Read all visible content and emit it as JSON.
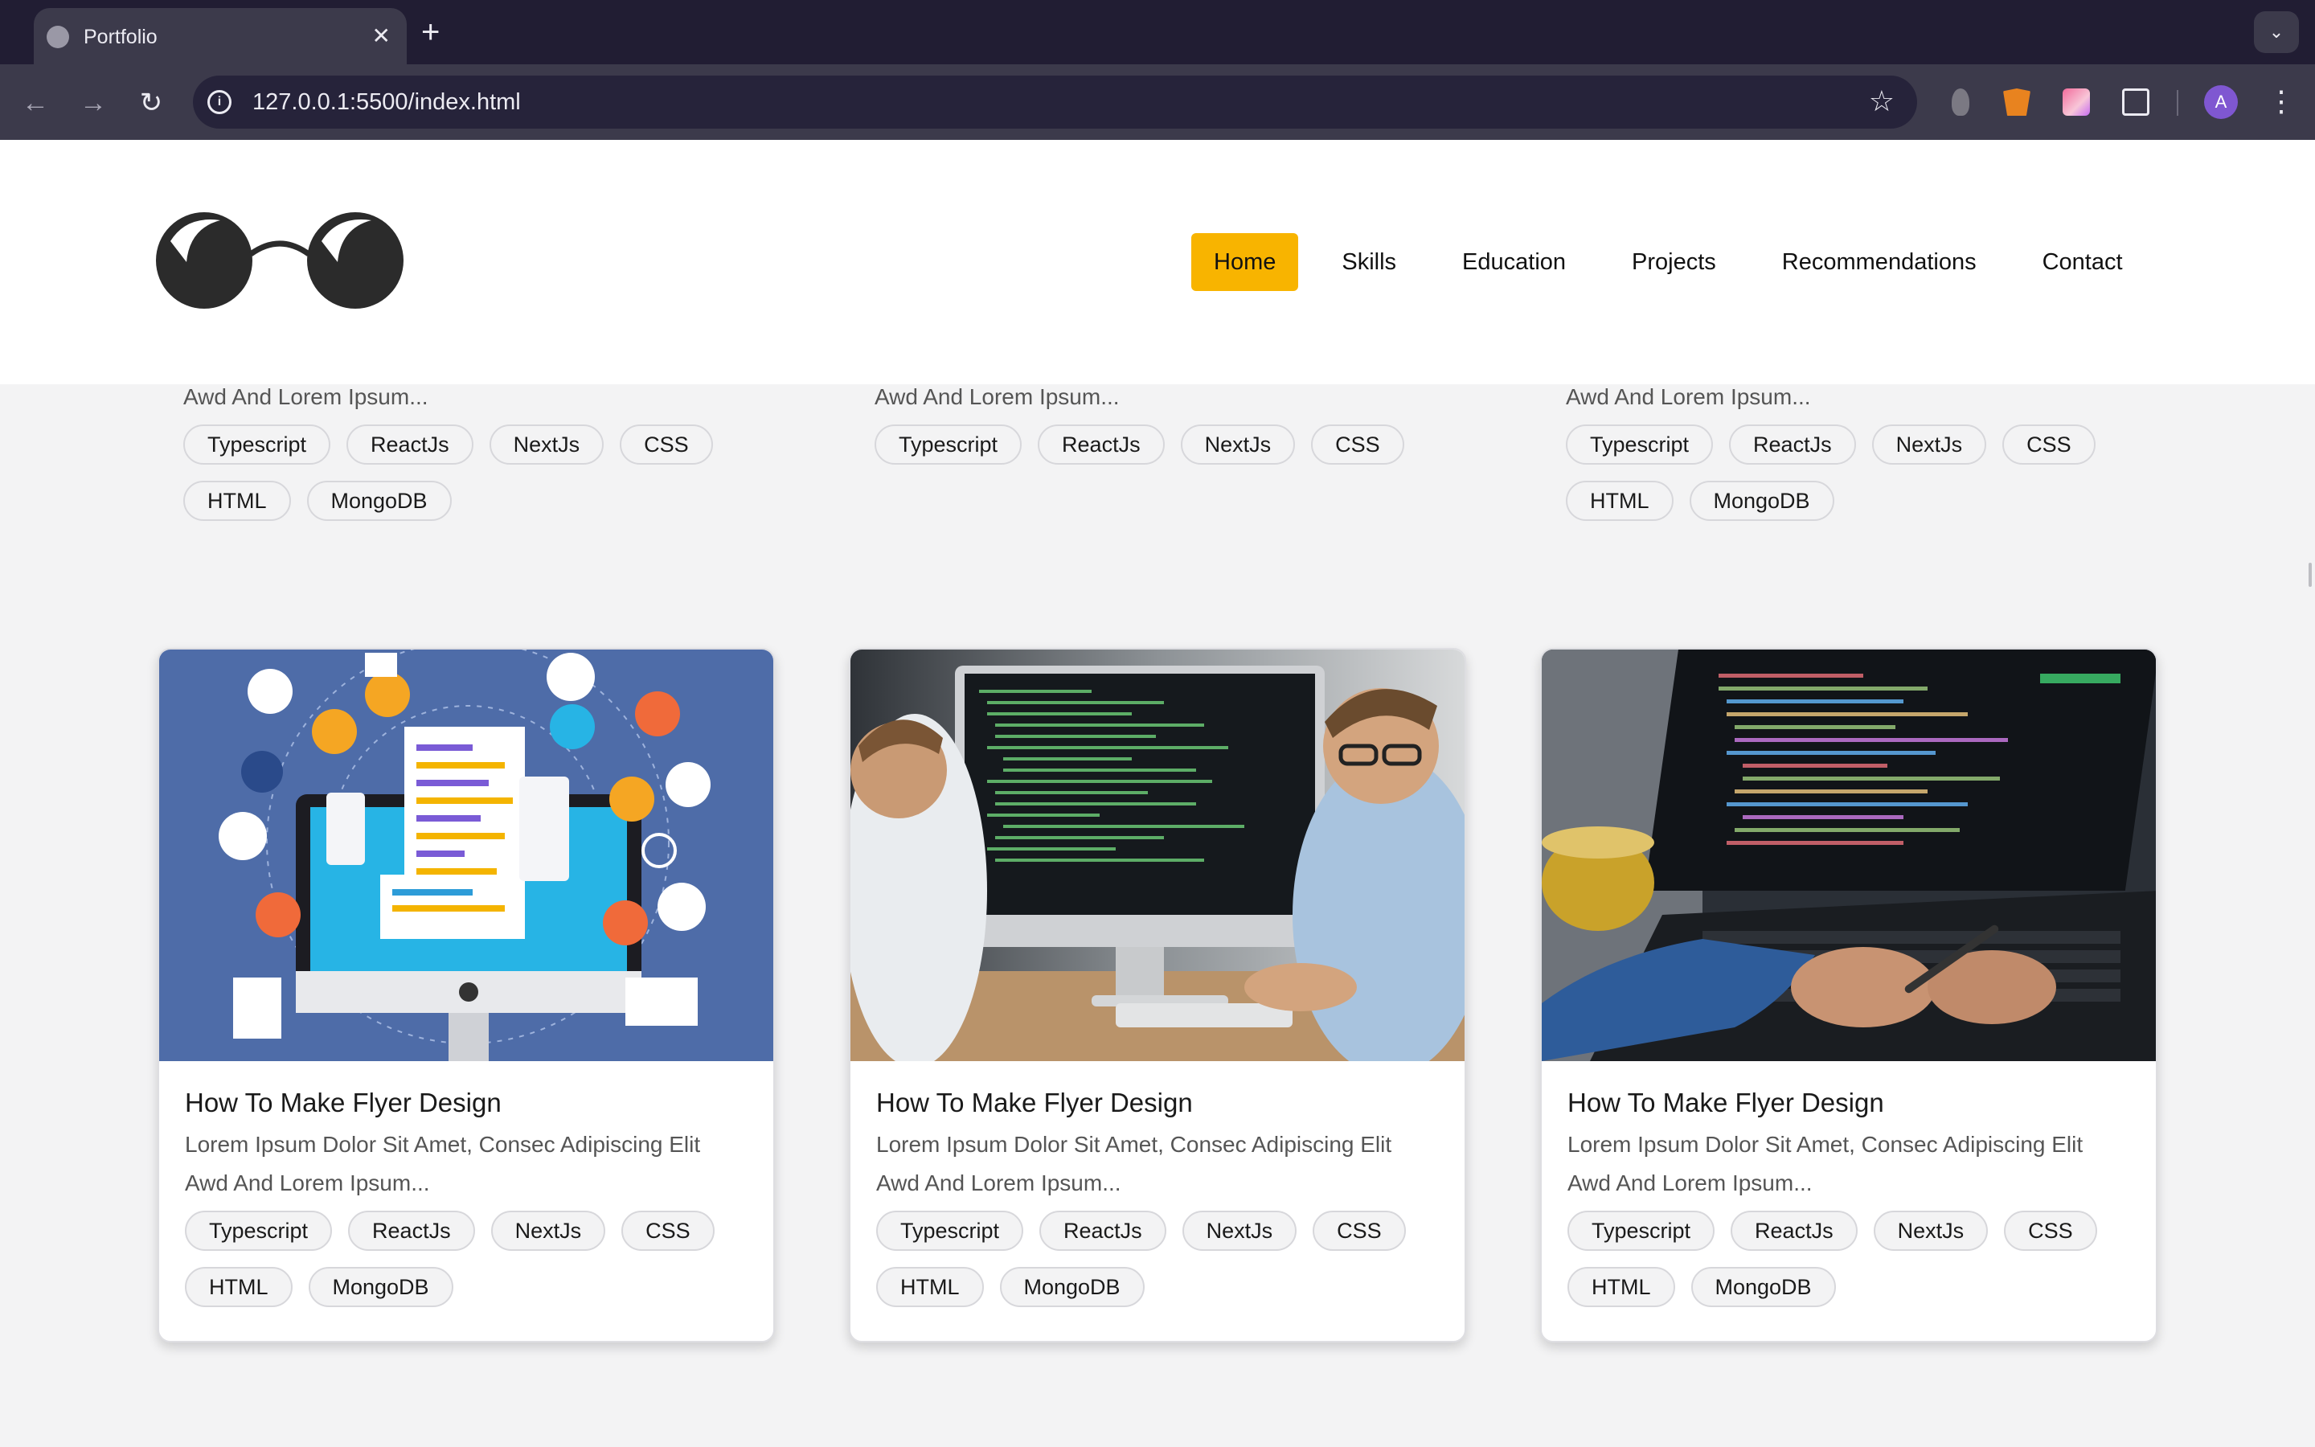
{
  "browser": {
    "tab_title": "Portfolio",
    "tab_close": "✕",
    "new_tab": "+",
    "tab_menu": "⌄",
    "url": "127.0.0.1:5500/index.html",
    "back": "←",
    "forward": "→",
    "reload": "↻",
    "star": "☆",
    "menu": "⋮",
    "profile_initial": "A",
    "info_icon": "i"
  },
  "site": {
    "nav": [
      "Home",
      "Skills",
      "Education",
      "Projects",
      "Recommendations",
      "Contact"
    ],
    "active_nav": "Home",
    "accent_color": "#f8b400"
  },
  "cards_top": [
    {
      "desc_line2": "Awd And Lorem Ipsum...",
      "tags": [
        "Typescript",
        "ReactJs",
        "NextJs",
        "CSS",
        "HTML",
        "MongoDB"
      ]
    },
    {
      "desc_line2": "Awd And Lorem Ipsum...",
      "tags": [
        "Typescript",
        "ReactJs",
        "NextJs",
        "CSS"
      ]
    },
    {
      "desc_line2": "Awd And Lorem Ipsum...",
      "tags": [
        "Typescript",
        "ReactJs",
        "NextJs",
        "CSS",
        "HTML",
        "MongoDB"
      ]
    }
  ],
  "cards": [
    {
      "title": "How To Make Flyer Design",
      "desc_line1": "Lorem Ipsum Dolor Sit Amet, Consec Adipiscing Elit",
      "desc_line2": "Awd And Lorem Ipsum...",
      "tags": [
        "Typescript",
        "ReactJs",
        "NextJs",
        "CSS",
        "HTML",
        "MongoDB"
      ]
    },
    {
      "title": "How To Make Flyer Design",
      "desc_line1": "Lorem Ipsum Dolor Sit Amet, Consec Adipiscing Elit",
      "desc_line2": "Awd And Lorem Ipsum...",
      "tags": [
        "Typescript",
        "ReactJs",
        "NextJs",
        "CSS",
        "HTML",
        "MongoDB"
      ]
    },
    {
      "title": "How To Make Flyer Design",
      "desc_line1": "Lorem Ipsum Dolor Sit Amet, Consec Adipiscing Elit",
      "desc_line2": "Awd And Lorem Ipsum...",
      "tags": [
        "Typescript",
        "ReactJs",
        "NextJs",
        "CSS",
        "HTML",
        "MongoDB"
      ]
    }
  ]
}
